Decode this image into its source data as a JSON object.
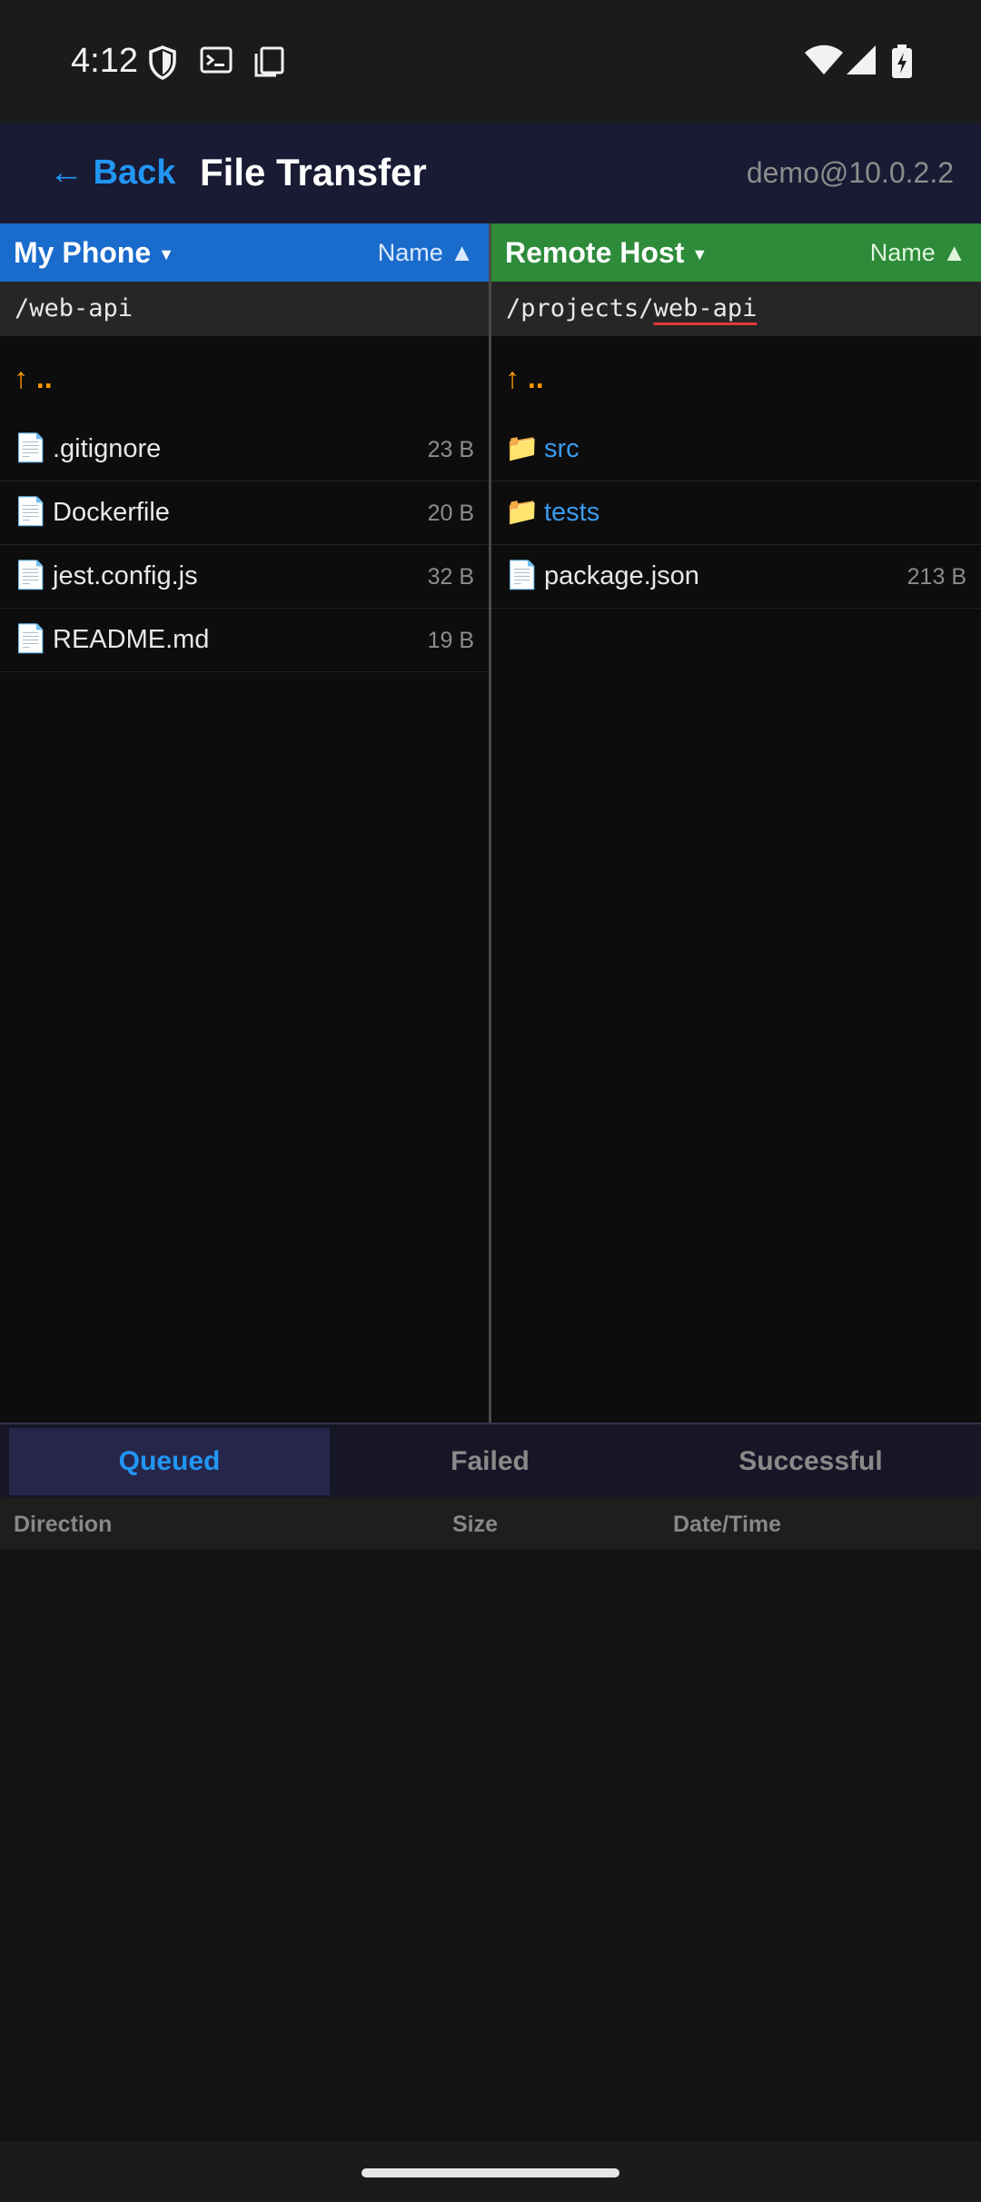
{
  "status_bar": {
    "time": "4:12",
    "icons_left": [
      "shield-icon",
      "terminal-icon",
      "copy-icon"
    ],
    "icons_right": [
      "wifi-icon",
      "signal-icon",
      "battery-charging-icon"
    ]
  },
  "app_bar": {
    "back_label": "← Back",
    "title": "File Transfer",
    "connection": "demo@10.0.2.2"
  },
  "local_pane": {
    "host_label": "My Phone",
    "sort_label": "Name ▲",
    "path": "/web-api",
    "up_label": "↑ ..",
    "items": [
      {
        "icon": "📄",
        "name": ".gitignore",
        "size": "23 B"
      },
      {
        "icon": "📄",
        "name": "Dockerfile",
        "size": "20 B"
      },
      {
        "icon": "📄",
        "name": "jest.config.js",
        "size": "32 B"
      },
      {
        "icon": "📄",
        "name": "README.md",
        "size": "19 B"
      }
    ]
  },
  "remote_pane": {
    "host_label": "Remote Host",
    "sort_label": "Name ▲",
    "path_prefix": "/projects/",
    "path_current": "web-api",
    "up_label": "↑ ..",
    "items": [
      {
        "icon": "📁",
        "name": "src",
        "size": ""
      },
      {
        "icon": "📁",
        "name": "tests",
        "size": ""
      },
      {
        "icon": "📄",
        "name": "package.json",
        "size": "213 B"
      }
    ]
  },
  "transfers": {
    "tabs": [
      "Queued",
      "Failed",
      "Successful"
    ],
    "active_tab": "Queued",
    "columns": [
      "Direction",
      "Size",
      "Date/Time"
    ]
  },
  "colors": {
    "accent": "#2196f3",
    "local_header": "#1a6ccc",
    "remote_header": "#2e8b3a",
    "up_arrow": "#ff9800"
  }
}
